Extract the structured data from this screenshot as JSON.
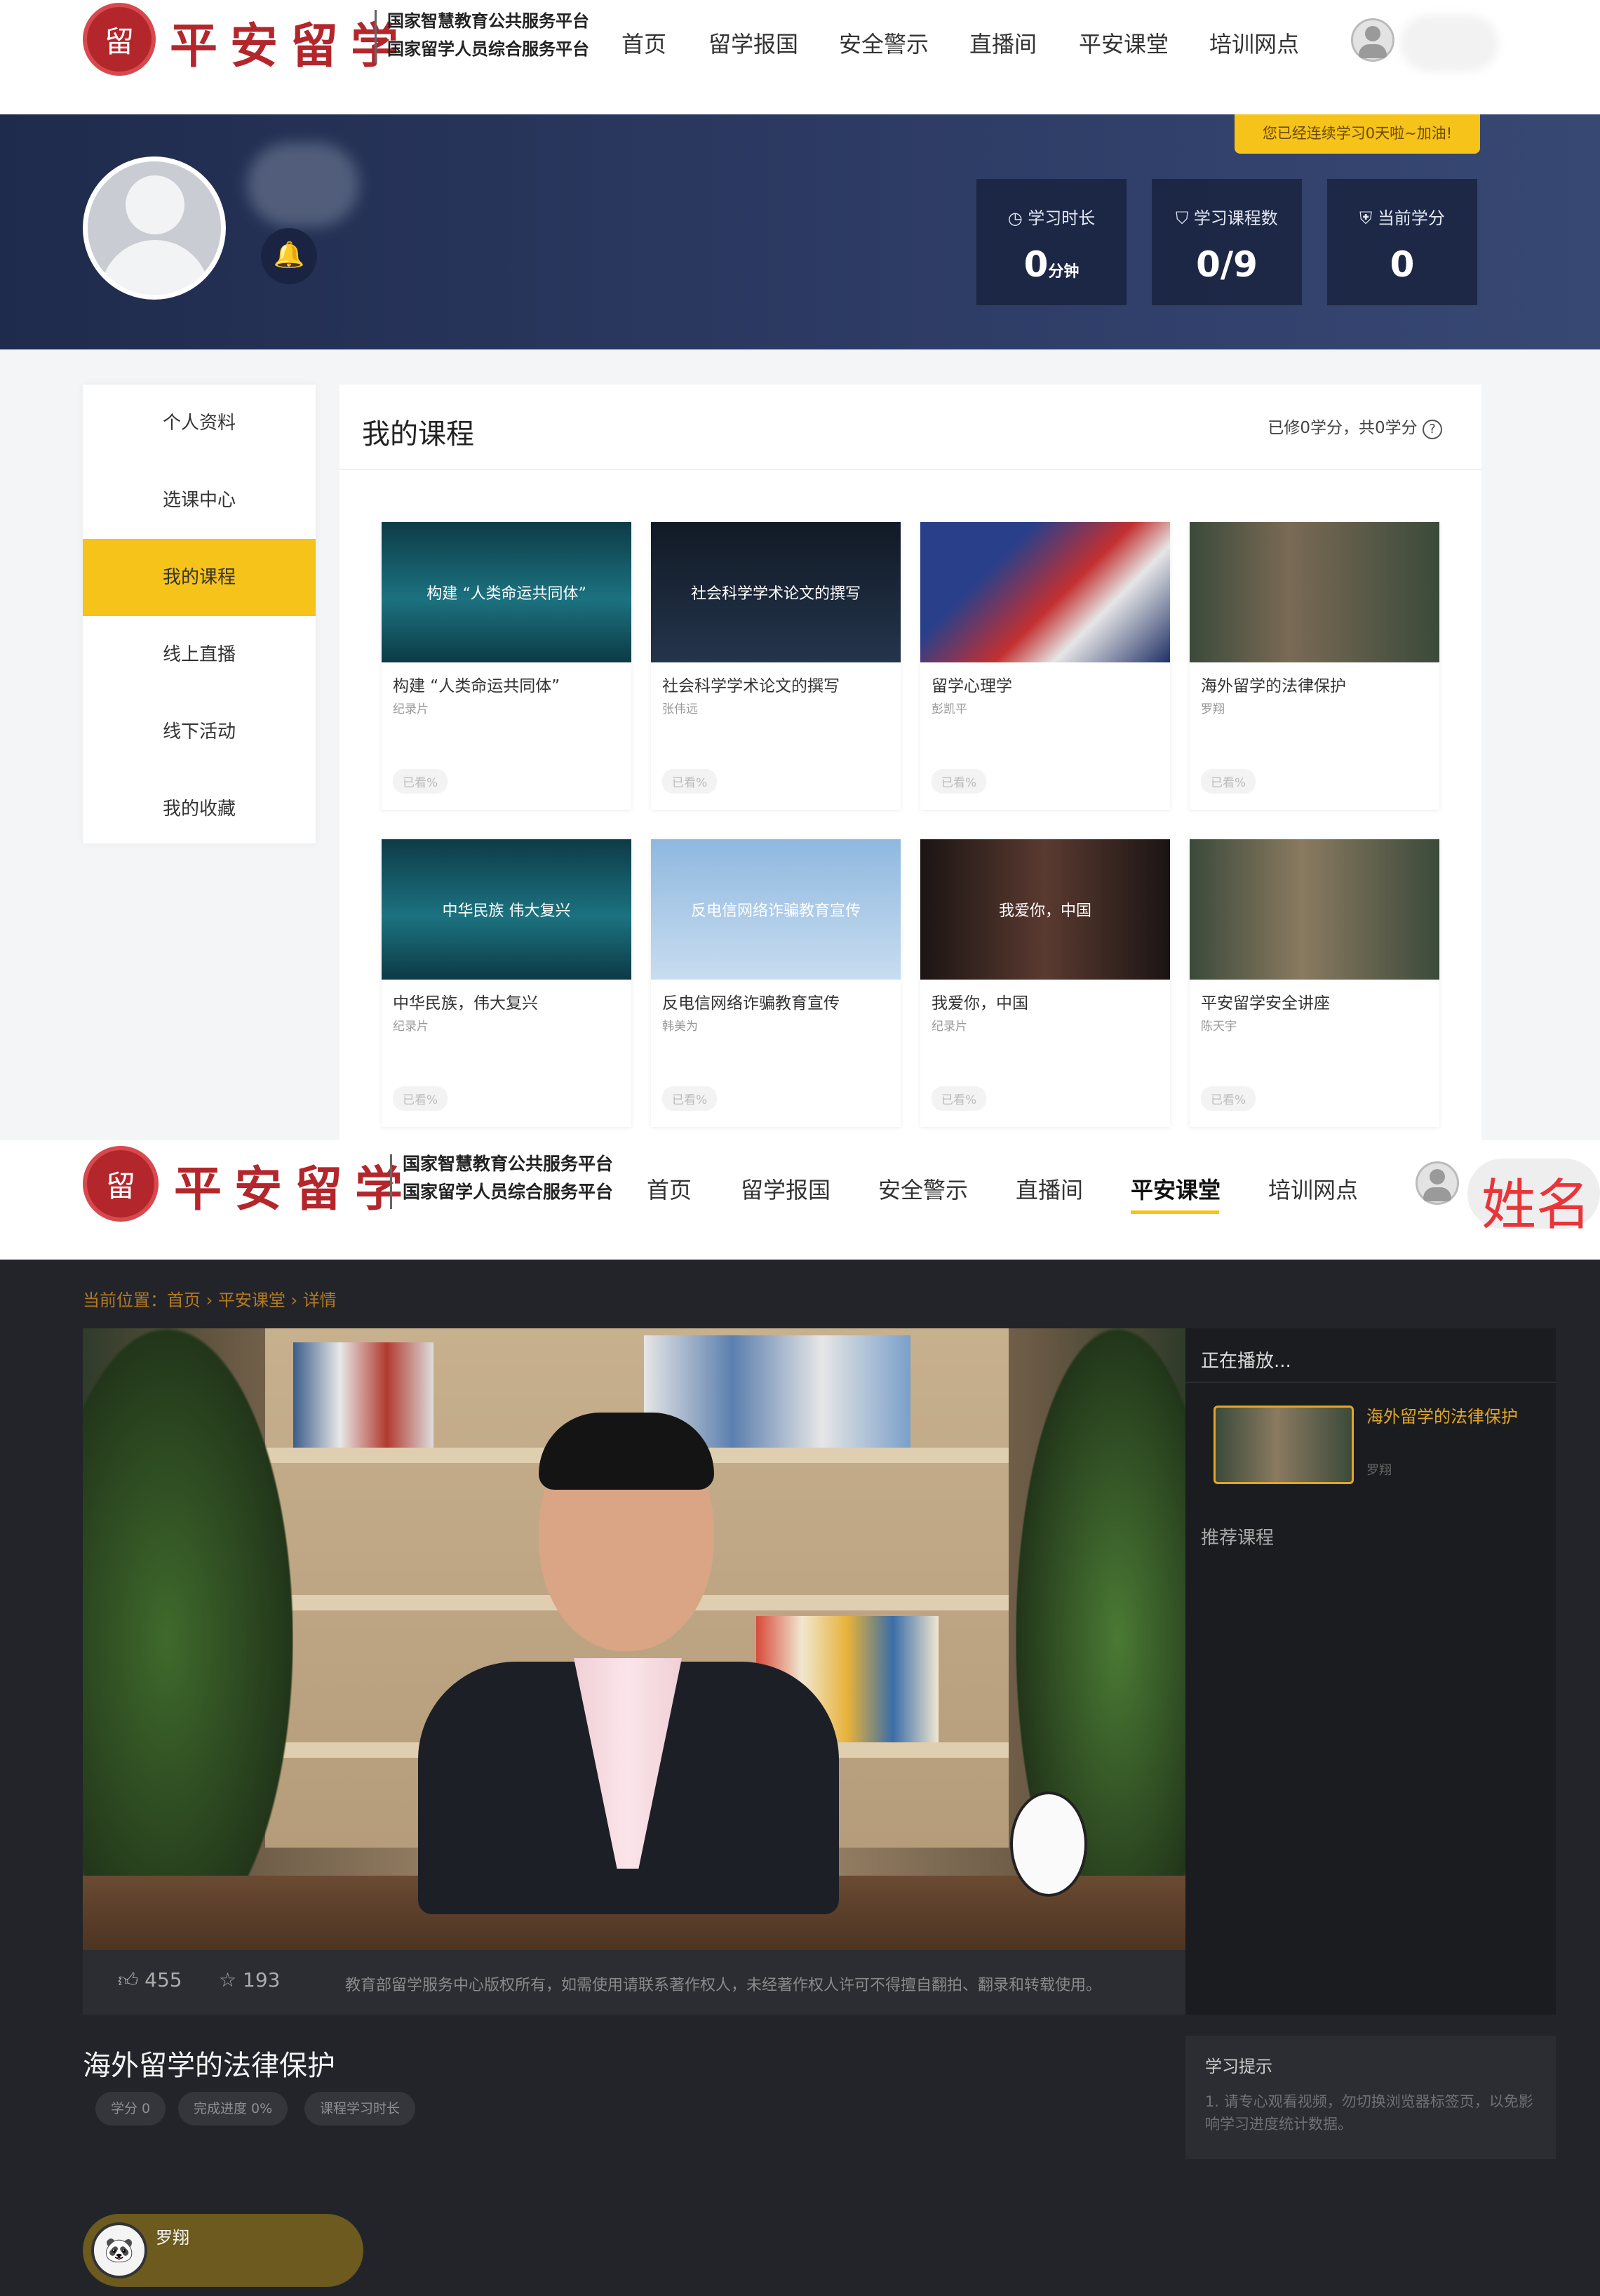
{
  "header": {
    "logo_seal": "留",
    "brand": "平安留学",
    "subtitle_1": "国家智慧教育公共服务平台",
    "subtitle_2": "国家留学人员综合服务平台"
  },
  "nav": [
    "首页",
    "留学报国",
    "安全警示",
    "直播间",
    "平安课堂",
    "培训网点"
  ],
  "active_nav_2": "平安课堂",
  "user_name": "姓名",
  "streak": "您已经连续学习0天啦~加油!",
  "stats": [
    {
      "label": "学习时长",
      "value": "0",
      "unit": "分钟",
      "icon": "clock-icon"
    },
    {
      "label": "学习课程数",
      "value": "0/9",
      "unit": "",
      "icon": "mortarboard-icon"
    },
    {
      "label": "当前学分",
      "value": "0",
      "unit": "",
      "icon": "shield-icon"
    }
  ],
  "sidebar": [
    "个人资料",
    "选课中心",
    "我的课程",
    "线上直播",
    "线下活动",
    "我的收藏"
  ],
  "sidebar_active": "我的课程",
  "courses_title": "我的课程",
  "credit_summary": "已修0学分，共0学分",
  "courses": [
    {
      "title": "构建 “人类命运共同体”",
      "sub": "纪录片",
      "progress": "已看%",
      "thumb_text": "构建 “人类命运共同体”",
      "bg": "linear-gradient(180deg,#0d3b47,#1c7280 55%,#0c3a45)"
    },
    {
      "title": "社会科学学术论文的撰写",
      "sub": "张伟远",
      "progress": "已看%",
      "thumb_text": "社会科学学术论文的撰写",
      "bg": "linear-gradient(180deg,#111a26,#24344b)"
    },
    {
      "title": "留学心理学",
      "sub": "彭凯平",
      "progress": "已看%",
      "thumb_text": "",
      "bg": "linear-gradient(135deg,#2a3f8a 30%,#c33030 55%,#e6e6e6 70%,#203066)"
    },
    {
      "title": "海外留学的法律保护",
      "sub": "罗翔",
      "progress": "已看%",
      "thumb_text": "",
      "bg": "linear-gradient(90deg,#3b4a3a,#7a6a55 40%,#3b4a3a)"
    },
    {
      "title": "中华民族，伟大复兴",
      "sub": "纪录片",
      "progress": "已看%",
      "thumb_text": "中华民族 伟大复兴",
      "bg": "linear-gradient(180deg,#0d3b47,#1c7280 55%,#0c3a45)"
    },
    {
      "title": "反电信网络诈骗教育宣传",
      "sub": "韩美为",
      "progress": "已看%",
      "thumb_text": "反电信网络诈骗教育宣传",
      "bg": "linear-gradient(180deg,#8fb8df,#c8ddf0)"
    },
    {
      "title": "我爱你，中国",
      "sub": "纪录片",
      "progress": "已看%",
      "thumb_text": "我爱你，中国",
      "bg": "linear-gradient(90deg,#1b1414,#5a3a30 50%,#1b1414)"
    },
    {
      "title": "平安留学安全讲座",
      "sub": "陈天宇",
      "progress": "已看%",
      "thumb_text": "",
      "bg": "linear-gradient(90deg,#3b4a3a,#8a7a60 45%,#3b4a3a)"
    }
  ],
  "breadcrumb": [
    "当前位置：",
    "首页",
    "平安课堂",
    "详情"
  ],
  "now_playing": "正在播放...",
  "playing_title": "海外留学的法律保护",
  "playing_author": "罗翔",
  "recommended": "推荐课程",
  "likes": "455",
  "favorites": "193",
  "copyright": "教育部留学服务中心版权所有，如需使用请联系著作权人，未经著作权人许可不得擅自翻拍、翻录和转载使用。",
  "video_title": "海外留学的法律保护",
  "tags": [
    "学分 0",
    "完成进度 0%",
    "课程学习时长"
  ],
  "tips_title": "学习提示",
  "tips_text": "1. 请专心观看视频，勿切换浏览器标签页，以免影响学习进度统计数据。",
  "author_name": "罗翔"
}
